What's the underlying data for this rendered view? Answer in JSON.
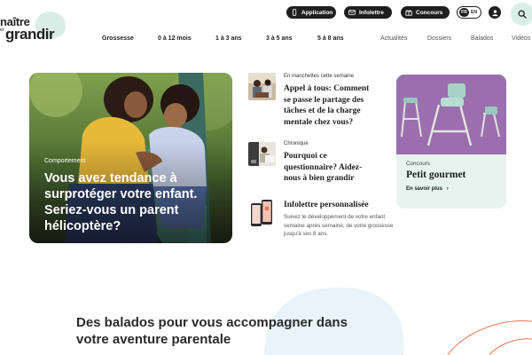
{
  "logo": {
    "line1": "naître",
    "line2": "et",
    "line3": "grandir"
  },
  "header": {
    "pills": {
      "app": {
        "label": "Application",
        "icon": "phone-icon"
      },
      "newsletter": {
        "label": "Infolettre",
        "icon": "mail-icon"
      },
      "contests": {
        "label": "Concours",
        "icon": "gift-icon"
      }
    },
    "lang": {
      "active": "FR",
      "other": "EN"
    }
  },
  "nav": {
    "main": [
      "Grossesse",
      "0 à 12 mois",
      "1 à 3 ans",
      "3 à 5 ans",
      "5 à 8 ans"
    ],
    "secondary": [
      "Actualités",
      "Dossiers",
      "Balados",
      "Vidéos"
    ]
  },
  "hero": {
    "category": "Comportement",
    "title": "Vous avez tendance à surprotéger votre enfant. Seriez-vous un parent hélicoptère?"
  },
  "articles": [
    {
      "category": "En manchettes cette semaine",
      "title": "Appel à tous: Comment se passe le partage des tâches et de la charge mentale chez vous?"
    },
    {
      "category": "Chronique",
      "title": "Pourquoi ce questionnaire? Aidez-nous à bien grandir"
    },
    {
      "category": "",
      "title": "Infolettre personnalisée",
      "description": "Suivez le développement de votre enfant semaine après semaine, de votre grossesse jusqu'à ses 8 ans."
    }
  ],
  "contest_card": {
    "category": "Concours",
    "title": "Petit gourmet",
    "link": "En savoir plus"
  },
  "podcast_section": {
    "title": "Des balados pour vous accompagner dans votre aventure parentale"
  },
  "colors": {
    "dark": "#1f1f1f",
    "mint": "#d8eee7",
    "card_bg": "#e7f3ee",
    "card_image": "#9b6fae",
    "blob_blue": "#e8f4fa",
    "accent_orange": "#e57a55"
  }
}
